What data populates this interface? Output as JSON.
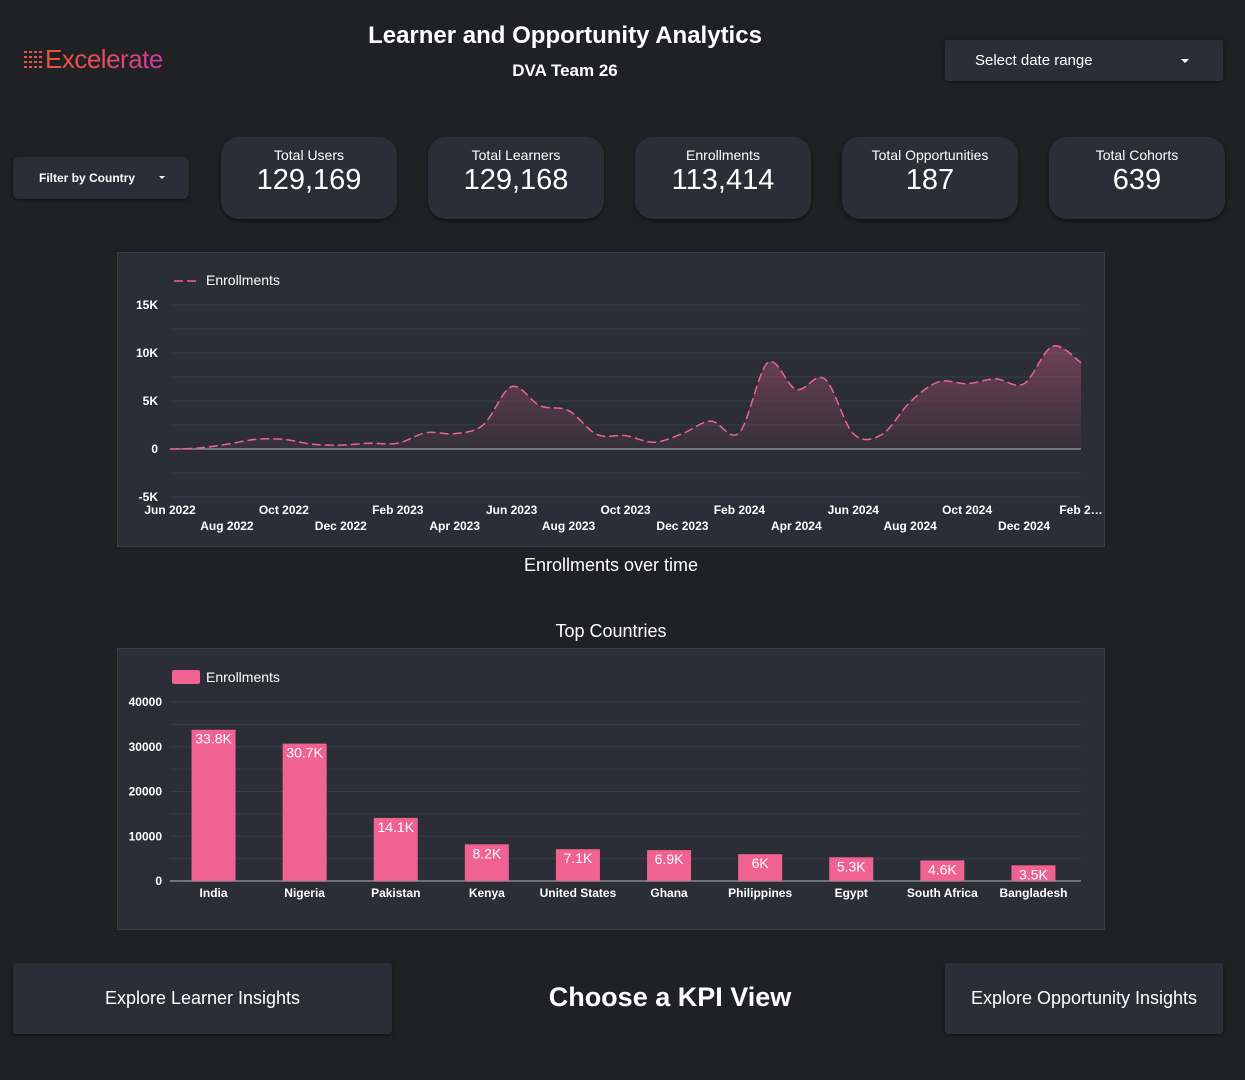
{
  "logo": {
    "text": "Excelerate"
  },
  "header": {
    "title": "Learner and Opportunity Analytics",
    "subtitle": "DVA Team 26"
  },
  "controls": {
    "date_range_label": "Select date range",
    "country_filter_label": "Filter by Country"
  },
  "kpis": [
    {
      "label": "Total Users",
      "value": "129,169"
    },
    {
      "label": "Total Learners",
      "value": "129,168"
    },
    {
      "label": "Enrollments",
      "value": "113,414"
    },
    {
      "label": "Total Opportunities",
      "value": "187"
    },
    {
      "label": "Total Cohorts",
      "value": "639"
    }
  ],
  "line_caption": "Enrollments over time",
  "bar_caption": "Top Countries",
  "footer": {
    "left_button": "Explore Learner Insights",
    "center_title": "Choose a KPI View",
    "right_button": "Explore Opportunity Insights"
  },
  "colors": {
    "accent": "#f06292",
    "background": "#202124",
    "card": "#2b2e36"
  },
  "chart_data": [
    {
      "type": "area",
      "series": [
        {
          "name": "Enrollments",
          "x": [
            "Jun 2022",
            "Jul 2022",
            "Aug 2022",
            "Sep 2022",
            "Oct 2022",
            "Nov 2022",
            "Dec 2022",
            "Jan 2023",
            "Feb 2023",
            "Mar 2023",
            "Apr 2023",
            "May 2023",
            "Jun 2023",
            "Jul 2023",
            "Aug 2023",
            "Sep 2023",
            "Oct 2023",
            "Nov 2023",
            "Dec 2023",
            "Jan 2024",
            "Feb 2024",
            "Mar 2024",
            "Apr 2024",
            "May 2024",
            "Jun 2024",
            "Jul 2024",
            "Aug 2024",
            "Sep 2024",
            "Oct 2024",
            "Nov 2024",
            "Dec 2024",
            "Jan 2025",
            "Feb 2025"
          ],
          "values": [
            0,
            100,
            500,
            1000,
            1000,
            500,
            400,
            600,
            600,
            1700,
            1600,
            2500,
            6500,
            4500,
            4000,
            1500,
            1400,
            700,
            1600,
            2900,
            1700,
            9000,
            6200,
            7300,
            1600,
            1500,
            4900,
            7000,
            6800,
            7300,
            6800,
            10700,
            9000
          ]
        }
      ],
      "x_tick_labels": [
        "Jun 2022",
        "Aug 2022",
        "Oct 2022",
        "Dec 2022",
        "Feb 2023",
        "Apr 2023",
        "Jun 2023",
        "Aug 2023",
        "Oct 2023",
        "Dec 2023",
        "Feb 2024",
        "Apr 2024",
        "Jun 2024",
        "Aug 2024",
        "Oct 2024",
        "Dec 2024",
        "Feb 2…"
      ],
      "y_ticks": [
        "15K",
        "10K",
        "5K",
        "0",
        "-5K"
      ],
      "ylim": [
        -5000,
        15000
      ],
      "grid": true,
      "legend": "top-left"
    },
    {
      "type": "bar",
      "categories": [
        "India",
        "Nigeria",
        "Pakistan",
        "Kenya",
        "United States",
        "Ghana",
        "Philippines",
        "Egypt",
        "South Africa",
        "Bangladesh"
      ],
      "series": [
        {
          "name": "Enrollments",
          "values": [
            33800,
            30700,
            14100,
            8200,
            7100,
            6900,
            6000,
            5300,
            4600,
            3500
          ],
          "data_labels": [
            "33.8K",
            "30.7K",
            "14.1K",
            "8.2K",
            "7.1K",
            "6.9K",
            "6K",
            "5.3K",
            "4.6K",
            "3.5K"
          ]
        }
      ],
      "y_ticks": [
        "40000",
        "30000",
        "20000",
        "10000",
        "0"
      ],
      "ylim": [
        0,
        40000
      ],
      "grid": true,
      "legend": "top-left"
    }
  ]
}
